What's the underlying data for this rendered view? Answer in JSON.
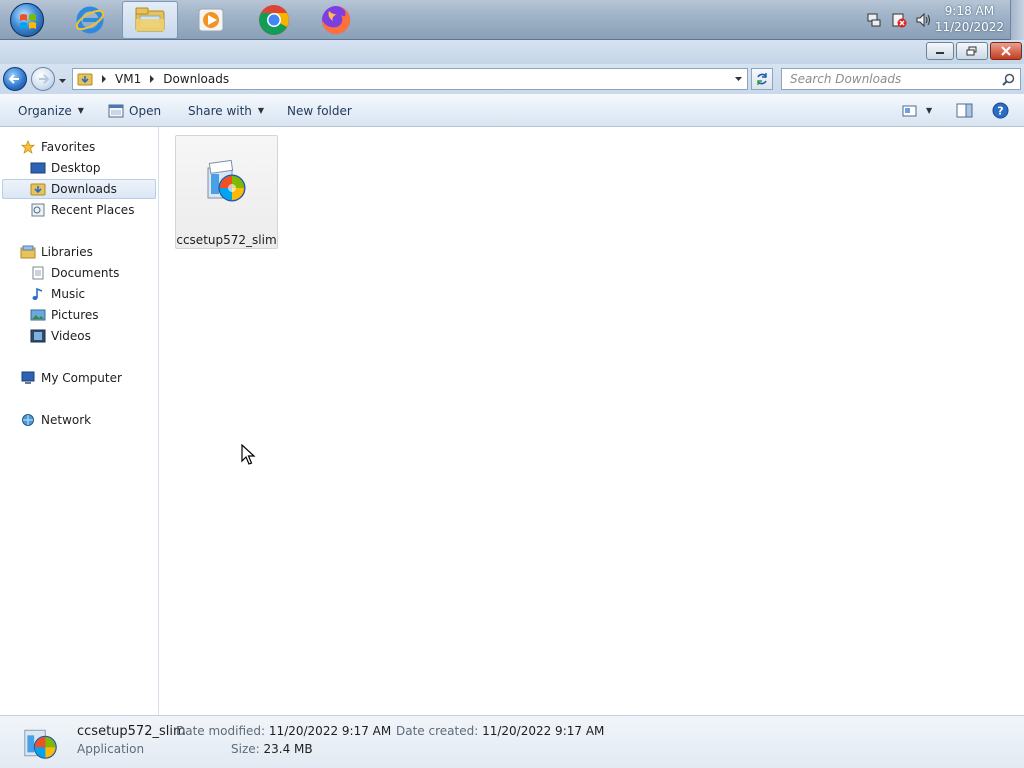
{
  "taskbar": {
    "clock_time": "9:18 AM",
    "clock_date": "11/20/2022",
    "pinned": [
      {
        "name": "internet-explorer-icon"
      },
      {
        "name": "windows-explorer-icon",
        "active": true
      },
      {
        "name": "media-player-icon"
      },
      {
        "name": "chrome-icon"
      },
      {
        "name": "firefox-icon"
      }
    ]
  },
  "address": {
    "crumbs": [
      "VM1",
      "Downloads"
    ],
    "search_placeholder": "Search Downloads"
  },
  "toolbar": {
    "organize": "Organize",
    "open": "Open",
    "share_with": "Share with",
    "new_folder": "New folder"
  },
  "nav": {
    "favorites": {
      "label": "Favorites",
      "items": [
        "Desktop",
        "Downloads",
        "Recent Places"
      ]
    },
    "libraries": {
      "label": "Libraries",
      "items": [
        "Documents",
        "Music",
        "Pictures",
        "Videos"
      ]
    },
    "computer": "My Computer",
    "network": "Network",
    "selected": "Downloads"
  },
  "files": [
    {
      "name": "ccsetup572_slim"
    }
  ],
  "details": {
    "name": "ccsetup572_slim",
    "type": "Application",
    "modified_label": "Date modified:",
    "modified_value": "11/20/2022 9:17 AM",
    "size_label": "Size:",
    "size_value": "23.4 MB",
    "created_label": "Date created:",
    "created_value": "11/20/2022 9:17 AM"
  },
  "colors": {
    "taskbar": "#9eb1c6",
    "selection": "#dbe7f6",
    "link_text": "#1e395b"
  }
}
